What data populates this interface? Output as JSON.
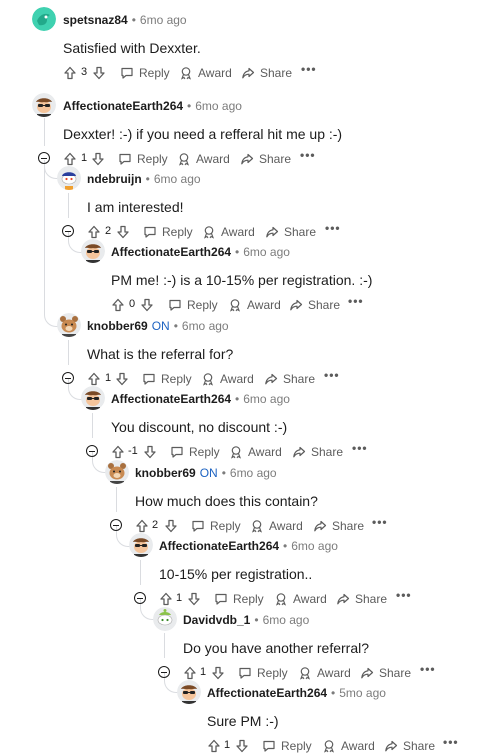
{
  "actions": {
    "reply": "Reply",
    "award": "Award",
    "share": "Share",
    "more": "•••"
  },
  "comments": [
    {
      "user": "spetsnaz84",
      "online": "",
      "time": "6mo ago",
      "body": "Satisfied with Dexxter.",
      "votes": "3",
      "avatar": "green-bird-avatar"
    },
    {
      "user": "AffectionateEarth264",
      "online": "",
      "time": "6mo ago",
      "body": "Dexxter! :-) if you need a refferal hit me up :-)",
      "votes": "1",
      "avatar": "sunglasses-avatar"
    },
    {
      "user": "ndebruijn",
      "online": "",
      "time": "6mo ago",
      "body": "I am interested!",
      "votes": "2",
      "avatar": "snoo-cap-avatar"
    },
    {
      "user": "AffectionateEarth264",
      "online": "",
      "time": "6mo ago",
      "body": "PM me! :-) is a 10-15% per registration. :-)",
      "votes": "0",
      "avatar": "sunglasses-avatar"
    },
    {
      "user": "knobber69",
      "online": "ON",
      "time": "6mo ago",
      "body": "What is the referral for?",
      "votes": "1",
      "avatar": "bear-avatar"
    },
    {
      "user": "AffectionateEarth264",
      "online": "",
      "time": "6mo ago",
      "body": "You discount, no discount :-)",
      "votes": "-1",
      "avatar": "sunglasses-avatar"
    },
    {
      "user": "knobber69",
      "online": "ON",
      "time": "6mo ago",
      "body": "How much does this contain?",
      "votes": "2",
      "avatar": "bear-avatar"
    },
    {
      "user": "AffectionateEarth264",
      "online": "",
      "time": "6mo ago",
      "body": "10-15% per registration..",
      "votes": "1",
      "avatar": "sunglasses-avatar"
    },
    {
      "user": "Davidvdb_1",
      "online": "",
      "time": "6mo ago",
      "body": "Do you have another referral?",
      "votes": "1",
      "avatar": "snoo-green-avatar"
    },
    {
      "user": "AffectionateEarth264",
      "online": "",
      "time": "5mo ago",
      "body": "Sure PM :-)",
      "votes": "1",
      "avatar": "sunglasses-avatar"
    }
  ],
  "colors": {
    "online": "#1d63c2",
    "thread_line": "#dadce0",
    "meta": "#7c7c7c"
  }
}
